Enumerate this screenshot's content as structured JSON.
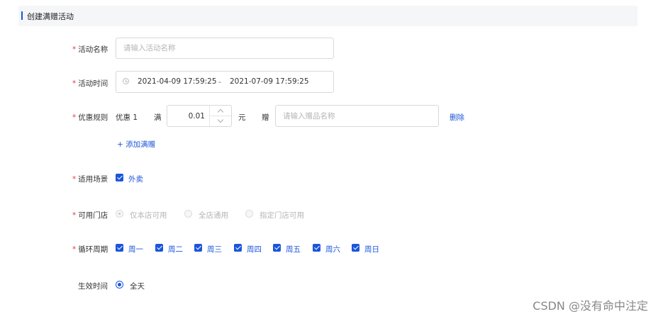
{
  "header": {
    "title": "创建满赠活动",
    "accent_color": "#1a56db"
  },
  "form": {
    "required_mark": "*",
    "activity_name": {
      "label": "活动名称",
      "placeholder": "请输入活动名称"
    },
    "activity_time": {
      "label": "活动时间",
      "start": "2021-04-09 17:59:25",
      "separator": "-",
      "end": "2021-07-09 17:59:25",
      "icon": "clock-icon"
    },
    "rule": {
      "label": "优惠规则",
      "name": "优惠 1",
      "full_label": "满",
      "amount": "0.01",
      "unit": "元",
      "gift_label": "赠",
      "gift_placeholder": "请输入赠品名称",
      "delete_label": "删除"
    },
    "add_rule": {
      "icon": "plus-icon",
      "label": "添加满赠"
    },
    "scene": {
      "label": "适用场景",
      "option": "外卖",
      "checked": true
    },
    "store": {
      "label": "可用门店",
      "options": [
        {
          "label": "仅本店可用",
          "selected": true,
          "disabled": true
        },
        {
          "label": "全店通用",
          "selected": false,
          "disabled": true
        },
        {
          "label": "指定门店可用",
          "selected": false,
          "disabled": true
        }
      ]
    },
    "cycle": {
      "label": "循环周期",
      "days": [
        {
          "label": "周一",
          "checked": true
        },
        {
          "label": "周二",
          "checked": true
        },
        {
          "label": "周三",
          "checked": true
        },
        {
          "label": "周四",
          "checked": true
        },
        {
          "label": "周五",
          "checked": true
        },
        {
          "label": "周六",
          "checked": true
        },
        {
          "label": "周日",
          "checked": true
        }
      ]
    },
    "effective_time": {
      "label": "生效时间",
      "option": "全天",
      "selected": true
    }
  },
  "watermark": "CSDN @没有命中注定"
}
